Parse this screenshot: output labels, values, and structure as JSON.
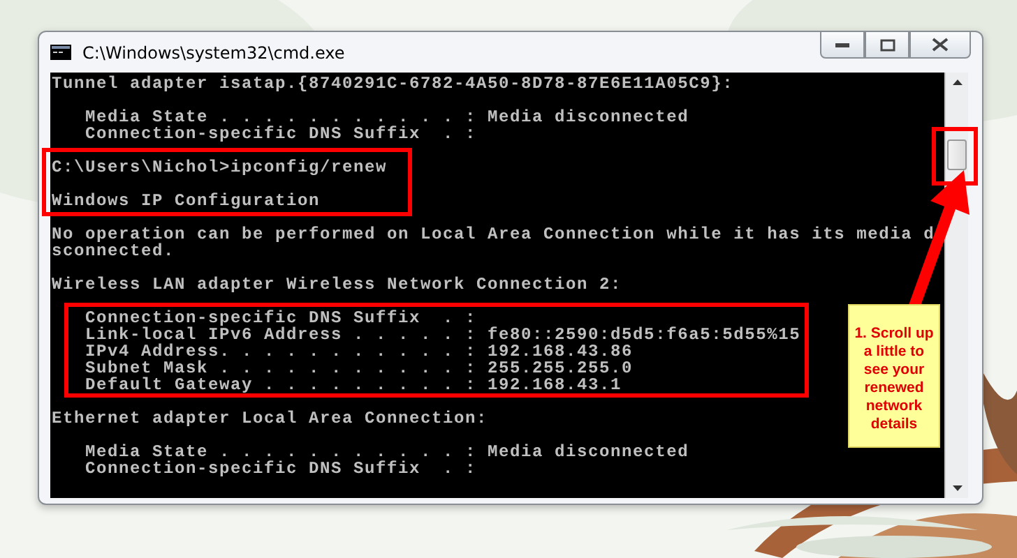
{
  "window": {
    "title": "C:\\Windows\\system32\\cmd.exe"
  },
  "console": {
    "blocks": [
      [
        "Tunnel adapter isatap.{8740291C-6782-4A50-8D78-87E6E11A05C9}:"
      ],
      [
        "   Media State . . . . . . . . . . . : Media disconnected",
        "   Connection-specific DNS Suffix  . :"
      ],
      [
        "C:\\Users\\Nichol>ipconfig/renew"
      ],
      [
        "Windows IP Configuration"
      ],
      [
        "No operation can be performed on Local Area Connection while it has its media d",
        "sconnected."
      ],
      [
        "Wireless LAN adapter Wireless Network Connection 2:"
      ],
      [
        "   Connection-specific DNS Suffix  . :",
        "   Link-local IPv6 Address . . . . . : fe80::2590:d5d5:f6a5:5d55%15",
        "   IPv4 Address. . . . . . . . . . . : 192.168.43.86",
        "   Subnet Mask . . . . . . . . . . . : 255.255.255.0",
        "   Default Gateway . . . . . . . . . : 192.168.43.1"
      ],
      [
        "Ethernet adapter Local Area Connection:"
      ],
      [
        "   Media State . . . . . . . . . . . : Media disconnected",
        "   Connection-specific DNS Suffix  . :"
      ]
    ]
  },
  "note": {
    "lines": [
      "1. Scroll up",
      "a little to",
      "see your",
      "renewed",
      "network",
      "details"
    ]
  }
}
